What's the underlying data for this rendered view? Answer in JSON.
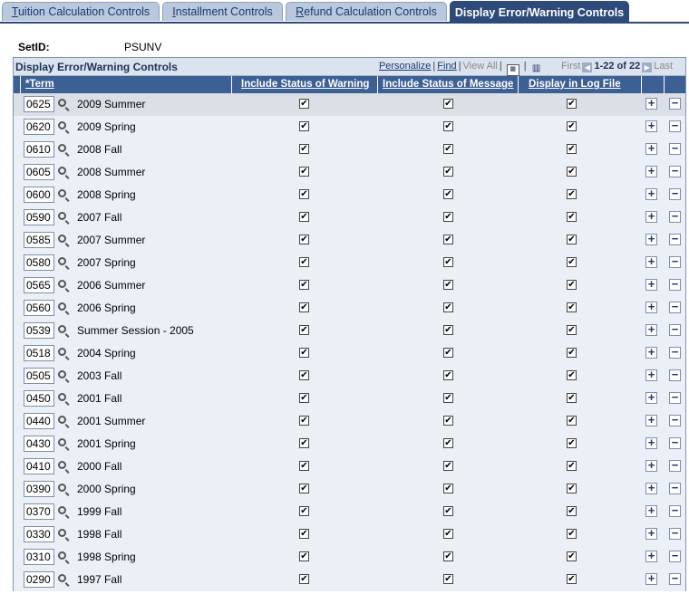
{
  "tabs": [
    {
      "label_u": "T",
      "label_rest": "uition Calculation Controls"
    },
    {
      "label_u": "I",
      "label_rest": "nstallment Controls"
    },
    {
      "label_u": "R",
      "label_rest": "efund Calculation Controls"
    },
    {
      "label_u": "",
      "label_rest": "Display Error/Warning Controls"
    }
  ],
  "setid": {
    "label": "SetID:",
    "value": "PSUNV"
  },
  "grid": {
    "title": "Display Error/Warning Controls",
    "nav": {
      "personalize": "Personalize",
      "find": "Find",
      "view_all": "View All",
      "first": "First",
      "range": "1-22 of 22",
      "last": "Last"
    },
    "columns": {
      "term": "*Term",
      "warning": "Include Status of Warning",
      "message": "Include Status of Message",
      "log": "Display in Log File"
    },
    "check_glyph": "✔",
    "plus": "+",
    "minus": "−",
    "rows": [
      {
        "term": "0625",
        "desc": "2009 Summer"
      },
      {
        "term": "0620",
        "desc": "2009 Spring"
      },
      {
        "term": "0610",
        "desc": "2008 Fall"
      },
      {
        "term": "0605",
        "desc": "2008 Summer"
      },
      {
        "term": "0600",
        "desc": "2008 Spring"
      },
      {
        "term": "0590",
        "desc": "2007 Fall"
      },
      {
        "term": "0585",
        "desc": "2007 Summer"
      },
      {
        "term": "0580",
        "desc": "2007 Spring"
      },
      {
        "term": "0565",
        "desc": "2006 Summer"
      },
      {
        "term": "0560",
        "desc": "2006 Spring"
      },
      {
        "term": "0539",
        "desc": "Summer Session - 2005"
      },
      {
        "term": "0518",
        "desc": "2004 Spring"
      },
      {
        "term": "0505",
        "desc": "2003 Fall"
      },
      {
        "term": "0450",
        "desc": "2001 Fall"
      },
      {
        "term": "0440",
        "desc": "2001 Summer"
      },
      {
        "term": "0430",
        "desc": "2001 Spring"
      },
      {
        "term": "0410",
        "desc": "2000 Fall"
      },
      {
        "term": "0390",
        "desc": "2000 Spring"
      },
      {
        "term": "0370",
        "desc": "1999 Fall"
      },
      {
        "term": "0330",
        "desc": "1998 Fall"
      },
      {
        "term": "0310",
        "desc": "1998 Spring"
      },
      {
        "term": "0290",
        "desc": "1997 Fall"
      }
    ]
  }
}
